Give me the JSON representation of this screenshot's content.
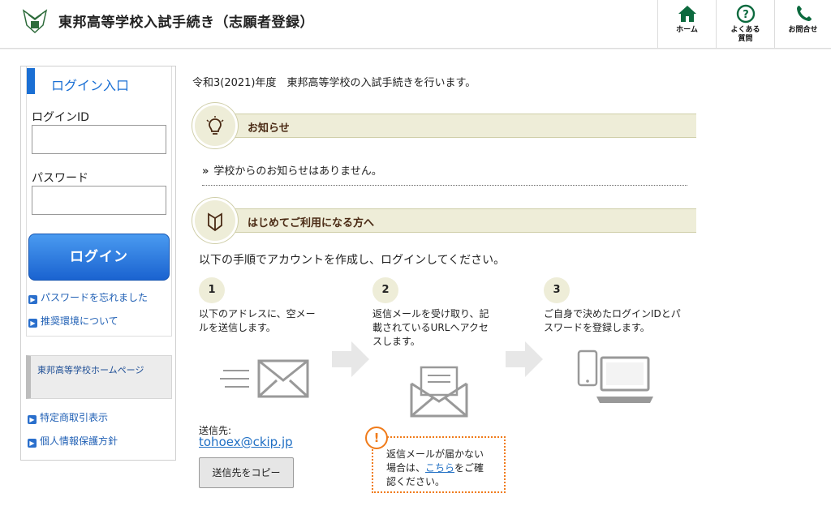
{
  "header": {
    "title": "東邦高等学校入試手続き（志願者登録）",
    "nav": [
      {
        "label": "ホーム",
        "icon": "home-icon"
      },
      {
        "label_line1": "よくある",
        "label_line2": "質問",
        "icon": "question-icon"
      },
      {
        "label": "お問合せ",
        "icon": "phone-icon"
      }
    ],
    "accent": "#0c6a3e"
  },
  "sidebar": {
    "login_title": "ログイン入口",
    "login_id_label": "ログインID",
    "login_id_value": "",
    "password_label": "パスワード",
    "password_value": "",
    "login_button": "ログイン",
    "links": [
      "パスワードを忘れました",
      "推奨環境について"
    ],
    "homepage_button": "東邦高等学校ホームページ",
    "footer_links": [
      "特定商取引表示",
      "個人情報保護方針"
    ]
  },
  "content": {
    "intro": "令和3(2021)年度　東邦高等学校の入試手続きを行います。",
    "notice": {
      "title": "お知らせ",
      "icon": "lightbulb-icon",
      "text": "学校からのお知らせはありません。"
    },
    "first_time": {
      "title": "はじめてご利用になる方へ",
      "icon": "beginner-mark-icon",
      "intro": "以下の手順でアカウントを作成し、ログインしてください。"
    },
    "steps": [
      {
        "num": "1",
        "line1": "以下のアドレスに、空メー",
        "line2": "ルを送信します。",
        "line3": ""
      },
      {
        "num": "2",
        "line1": "返信メールを受け取り、記",
        "line2": "載されているURLへアクセ",
        "line3": "スします。"
      },
      {
        "num": "3",
        "line1": "ご自身で決めたログインIDとパ",
        "line2": "スワードを登録します。",
        "line3": ""
      }
    ],
    "destination_label": "送信先:",
    "destination_email": "tohoex@ckip.jp",
    "copy_button": "送信先をコピー",
    "warning": {
      "line1": "返信メールが届かない",
      "line2_pre": "場合は、",
      "link": "こちら",
      "line2_post": "をご確",
      "line3": "認ください。"
    }
  }
}
